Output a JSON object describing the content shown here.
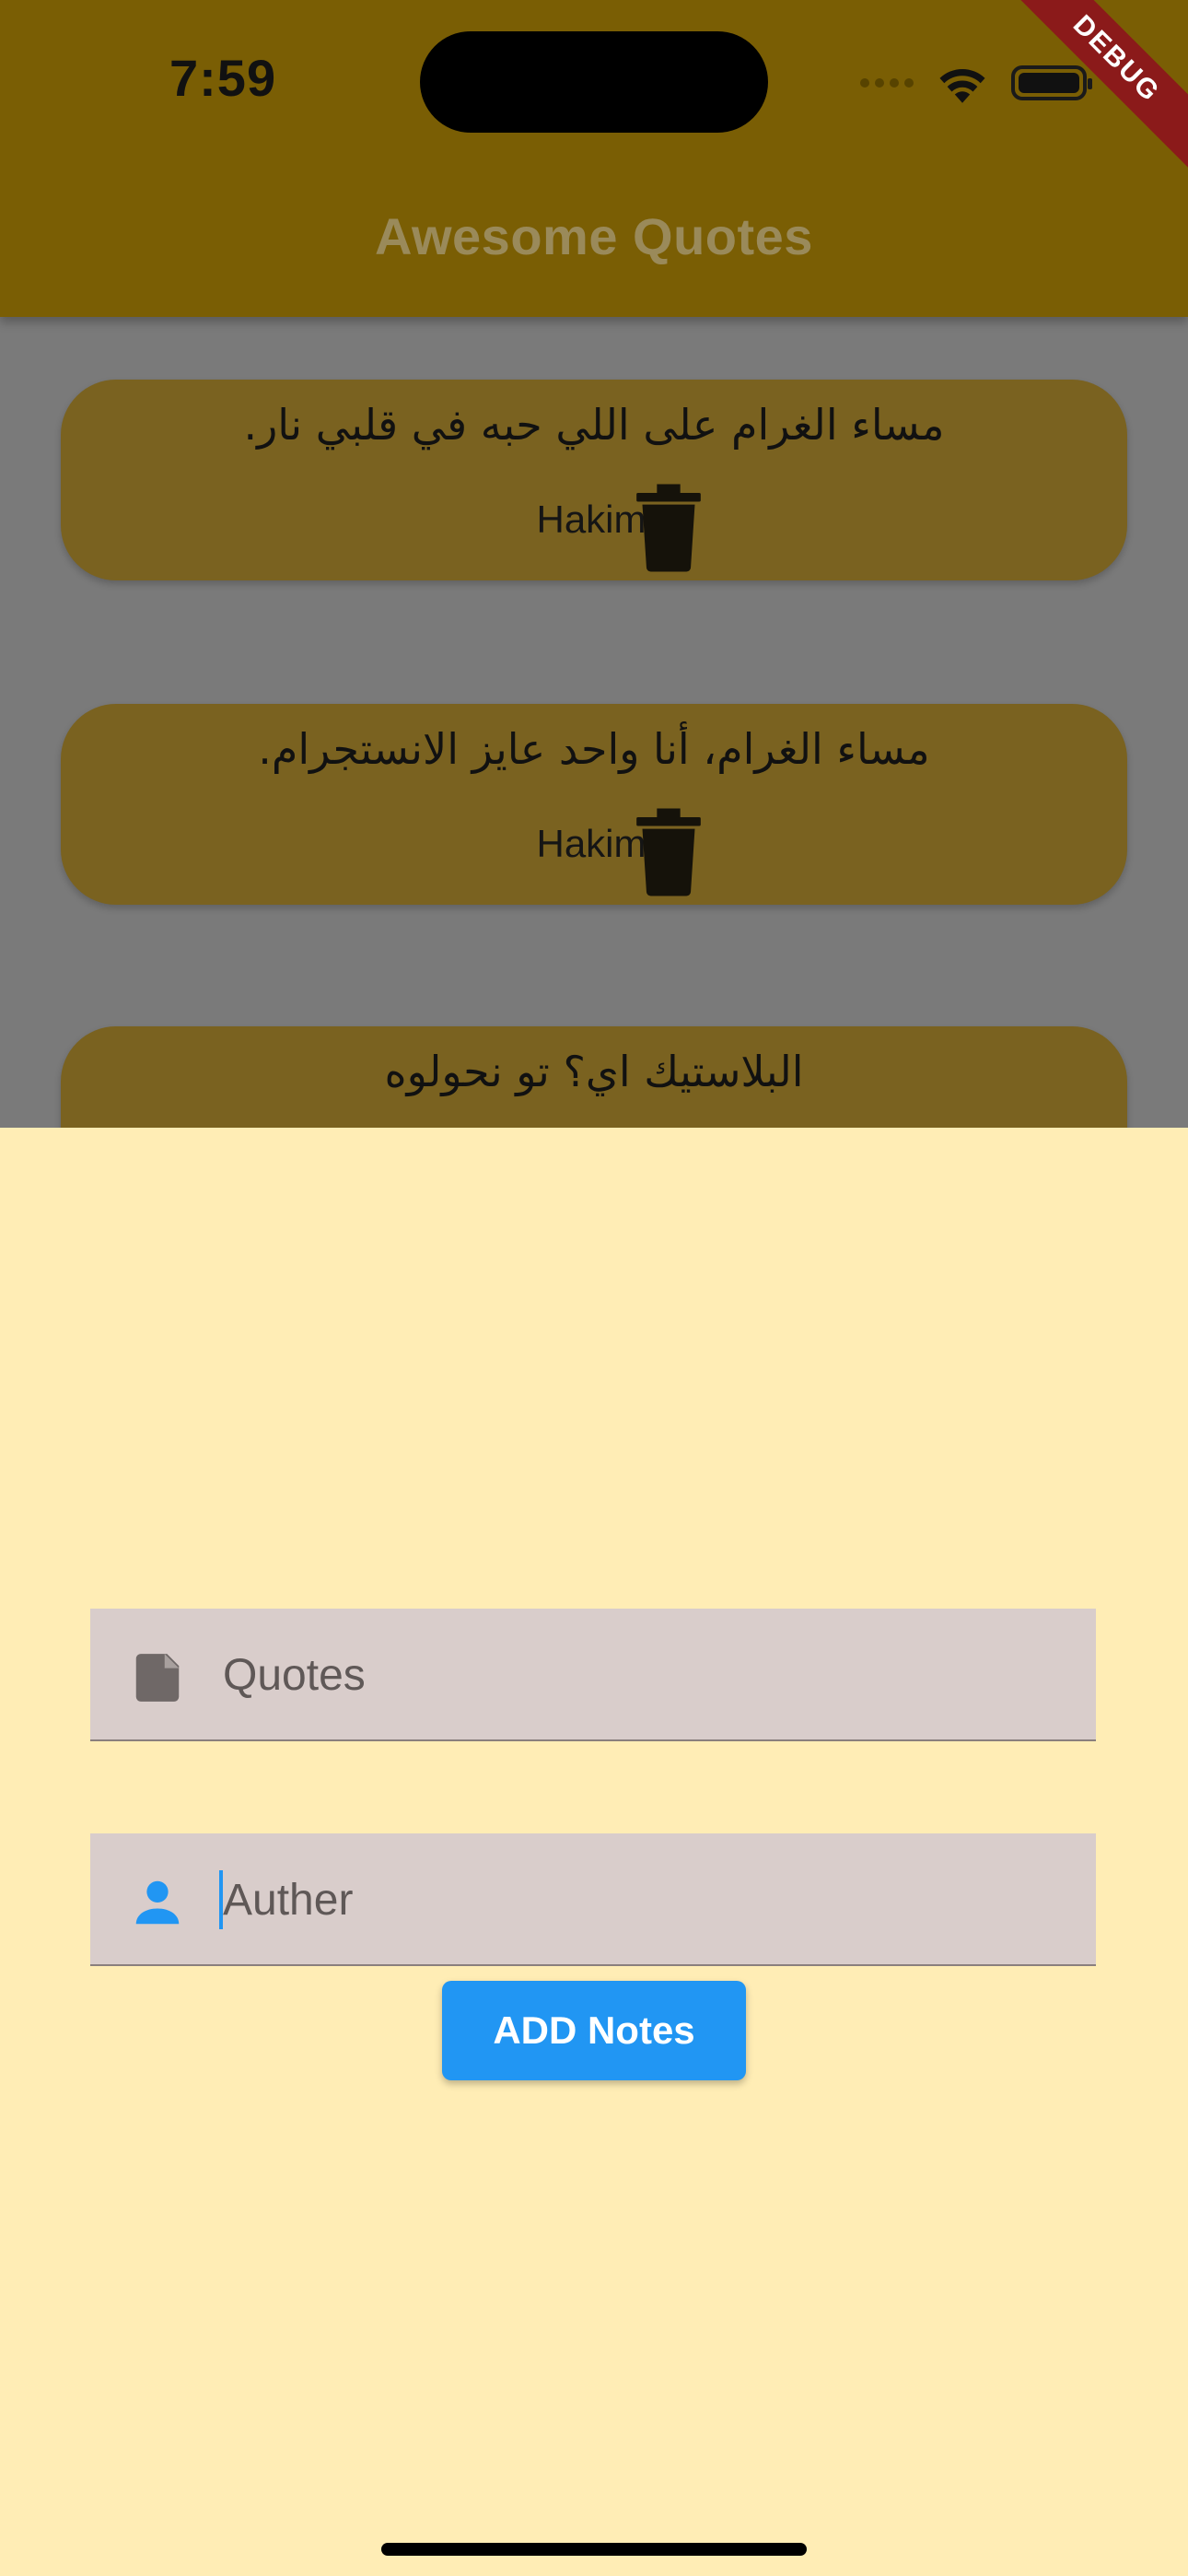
{
  "status_bar": {
    "time": "7:59"
  },
  "debug_banner": "DEBUG",
  "app_bar": {
    "title": "Awesome Quotes"
  },
  "quotes": [
    {
      "text": "مساء الغرام على اللي حبه في قلبي نار.",
      "author": "Hakim"
    },
    {
      "text": "مساء الغرام، أنا واحد عايز الانستجرام.",
      "author": "Hakim"
    },
    {
      "text": "البلاستيك اي؟ تو نحولوه",
      "author": ""
    }
  ],
  "form": {
    "quote_field": {
      "placeholder": "Quotes",
      "value": ""
    },
    "author_field": {
      "placeholder": "Auther",
      "value": ""
    },
    "add_button": "ADD Notes"
  },
  "colors": {
    "app_bar": "#7A5E04",
    "card": "#7A6220",
    "sheet": "#FFEDB5",
    "field": "#D9CDCB",
    "button": "#2196F3",
    "debug": "#8B1A1A"
  },
  "icons": {
    "quote_field": "note-icon",
    "author_field": "person-icon",
    "delete": "trash-icon"
  }
}
